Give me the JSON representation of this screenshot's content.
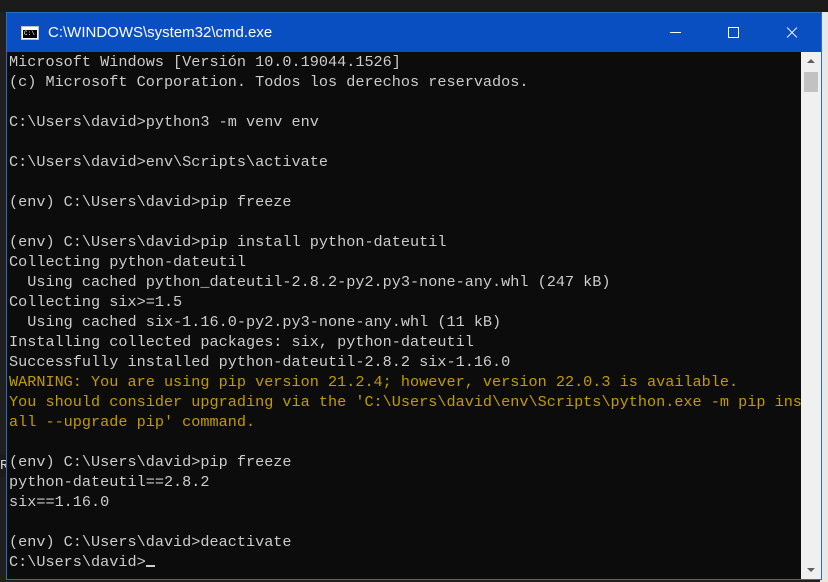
{
  "window": {
    "title": "C:\\WINDOWS\\system32\\cmd.exe",
    "icon": "cmd-app-icon",
    "controls": [
      "minimize-icon",
      "maximize-icon",
      "close-icon"
    ]
  },
  "colors": {
    "titlebar": "#0a4fc2",
    "console_background": "#0c0c0c",
    "console_text": "#cccccc",
    "warning_text": "#c19c00"
  },
  "console": {
    "lines": [
      "Microsoft Windows [Versión 10.0.19044.1526]",
      "(c) Microsoft Corporation. Todos los derechos reservados.",
      "",
      "C:\\Users\\david>python3 -m venv env",
      "",
      "C:\\Users\\david>env\\Scripts\\activate",
      "",
      "(env) C:\\Users\\david>pip freeze",
      "",
      "(env) C:\\Users\\david>pip install python-dateutil",
      "Collecting python-dateutil",
      "  Using cached python_dateutil-2.8.2-py2.py3-none-any.whl (247 kB)",
      "Collecting six>=1.5",
      "  Using cached six-1.16.0-py2.py3-none-any.whl (11 kB)",
      "Installing collected packages: six, python-dateutil",
      "Successfully installed python-dateutil-2.8.2 six-1.16.0",
      "WARNING: You are using pip version 21.2.4; however, version 22.0.3 is available.",
      "You should consider upgrading via the 'C:\\Users\\david\\env\\Scripts\\python.exe -m pip inst",
      "all --upgrade pip' command.",
      "",
      "(env) C:\\Users\\david>pip freeze",
      "python-dateutil==2.8.2",
      "six==1.16.0",
      "",
      "(env) C:\\Users\\david>deactivate",
      "C:\\Users\\david>"
    ]
  },
  "background": {
    "left_letter": "R"
  }
}
